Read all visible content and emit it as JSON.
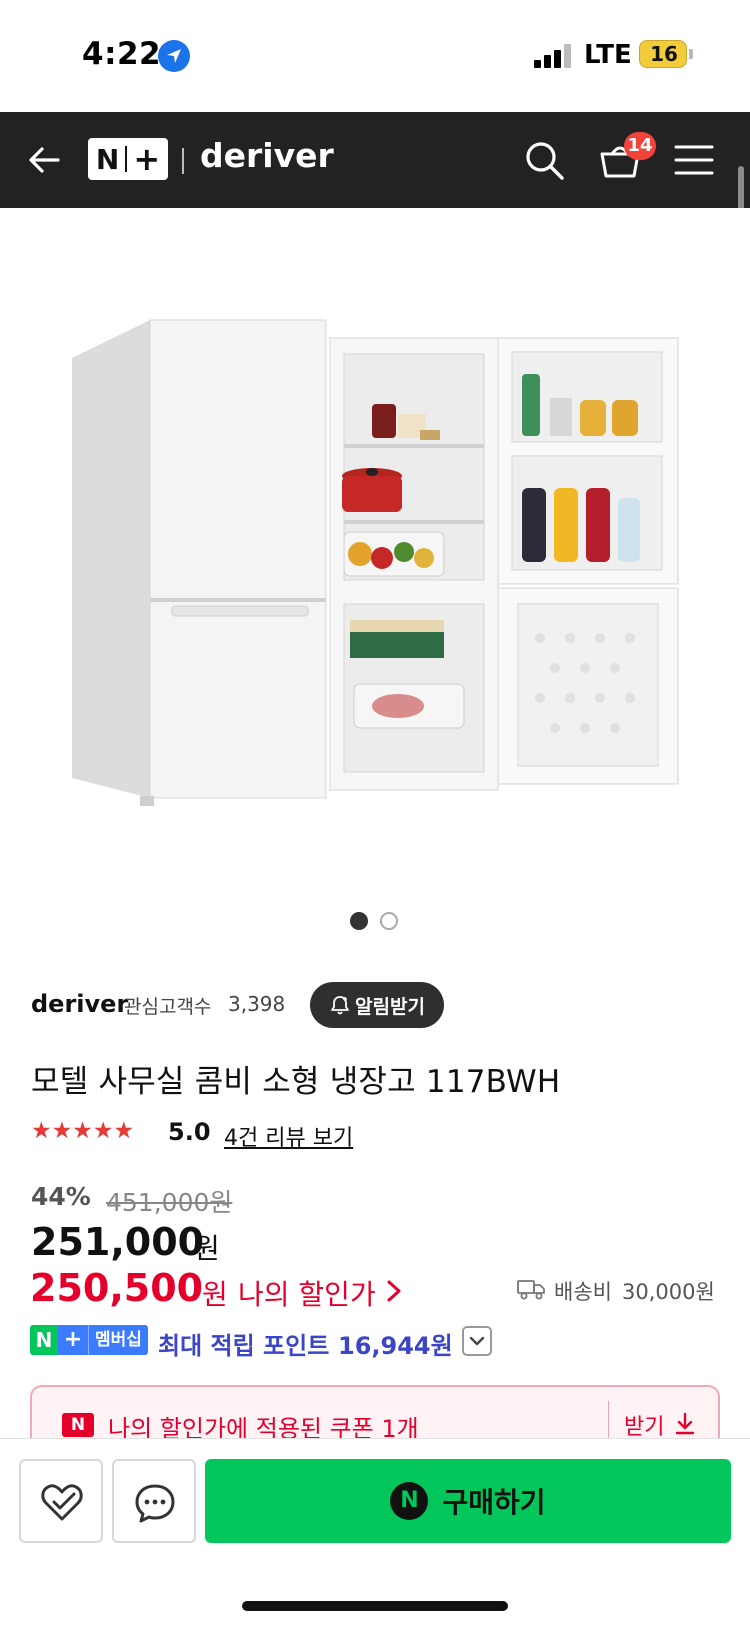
{
  "status_bar": {
    "time": "4:22",
    "network": "LTE",
    "battery": "16"
  },
  "header": {
    "logo_n": "N",
    "logo_plus": "+",
    "brand": "deriver",
    "cart_count": "14"
  },
  "carousel": {
    "total": 2,
    "active_index": 0
  },
  "seller": {
    "name": "deriver",
    "fans_label": "관심고객수",
    "fans_count": "3,398",
    "notify_label": "알림받기"
  },
  "product": {
    "title": "모텔 사무실 콤비 소형 냉장고 117BWH",
    "stars": "★★★★★",
    "rating": "5.0",
    "review_link": "4건 리뷰 보기"
  },
  "price": {
    "discount_rate": "44%",
    "original_price": "451,000원",
    "sale_price": "251,000",
    "sale_currency": "원",
    "my_price": "250,500",
    "my_currency": "원",
    "my_price_label": "나의 할인가"
  },
  "shipping": {
    "label": "배송비",
    "fee": "30,000원"
  },
  "membership": {
    "badge_n": "N",
    "badge_plus": "+",
    "badge_label": "멤버십",
    "points_label": "최대 적립 포인트",
    "points_value": "16,944원"
  },
  "coupon": {
    "badge": "N",
    "text": "나의 할인가에 적용된 쿠폰 1개",
    "receive_label": "받기"
  },
  "bottom_bar": {
    "buy_badge": "N",
    "buy_label": "구매하기"
  },
  "colors": {
    "nav_bg": "#222222",
    "accent_red": "#e4002b",
    "naver_green": "#03c75a",
    "membership_blue": "#3a7bff",
    "points_blue": "#3b45c8"
  }
}
